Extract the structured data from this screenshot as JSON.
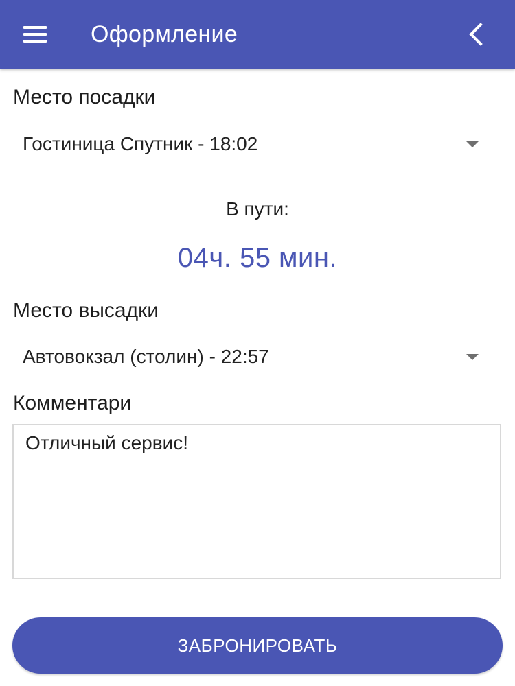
{
  "appbar": {
    "title": "Оформление",
    "menu_icon": "hamburger-menu-icon",
    "back_icon": "chevron-left-icon",
    "color": "#4a56b4"
  },
  "boarding": {
    "label": "Место посадки",
    "selected": "Гостиница Спутник - 18:02"
  },
  "travel": {
    "label": "В пути:",
    "duration": "04ч. 55 мин.",
    "color": "#4a56b4"
  },
  "dropoff": {
    "label": "Место высадки",
    "selected": "Автовокзал (столин) - 22:57"
  },
  "comment": {
    "label": "Комментари",
    "value": "Отличный сервис!"
  },
  "actions": {
    "book_label": "ЗАБРОНИРОВАТЬ"
  }
}
